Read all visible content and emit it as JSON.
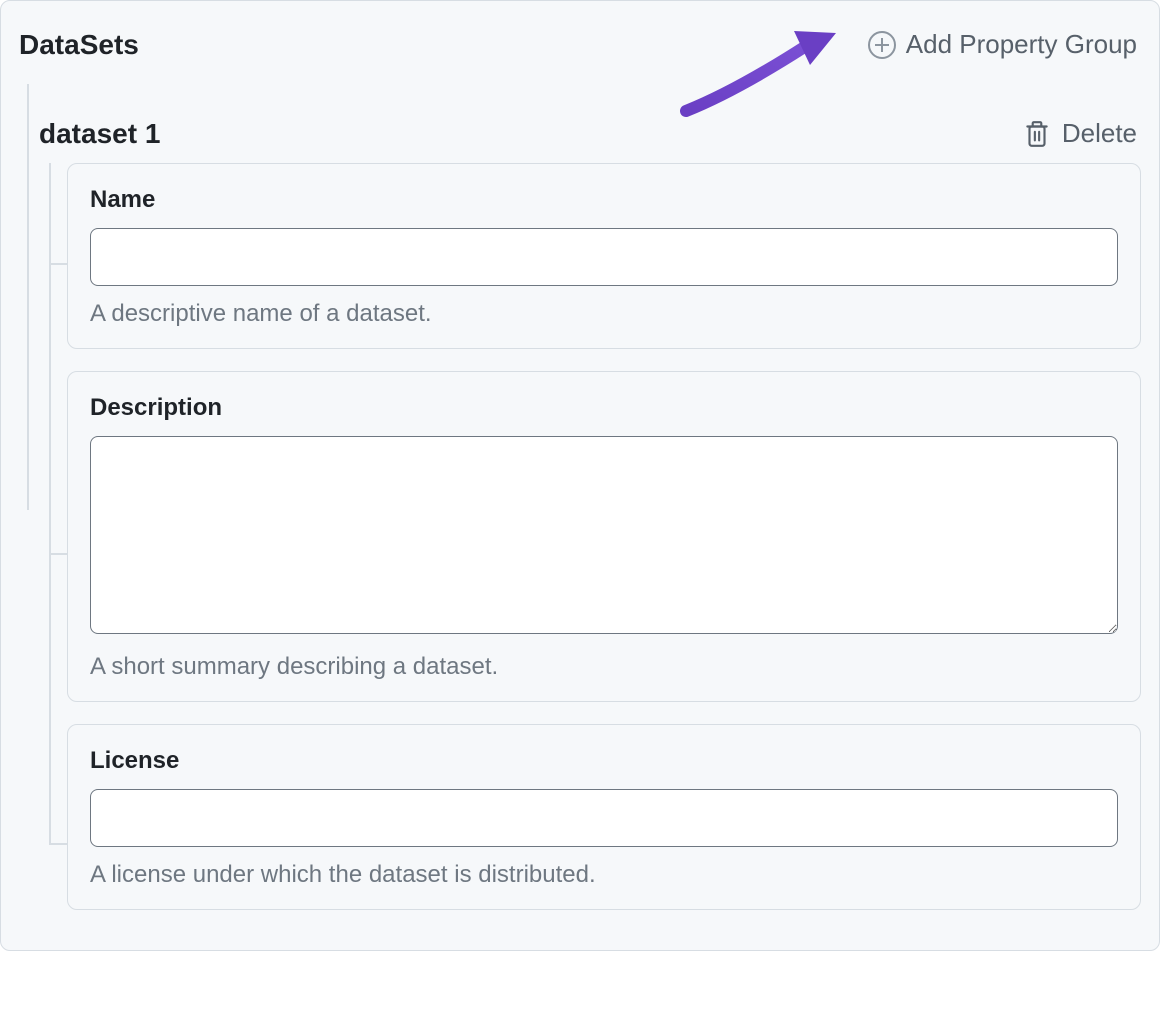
{
  "panel": {
    "title": "DataSets",
    "add_group_label": "Add Property Group"
  },
  "group": {
    "title": "dataset 1",
    "delete_label": "Delete",
    "fields": [
      {
        "label": "Name",
        "help": "A descriptive name of a dataset.",
        "value": ""
      },
      {
        "label": "Description",
        "help": "A short summary describing a dataset.",
        "value": ""
      },
      {
        "label": "License",
        "help": "A license under which the dataset is distributed.",
        "value": ""
      }
    ]
  },
  "annotation": {
    "arrow_points_to": "add-property-group-button"
  }
}
